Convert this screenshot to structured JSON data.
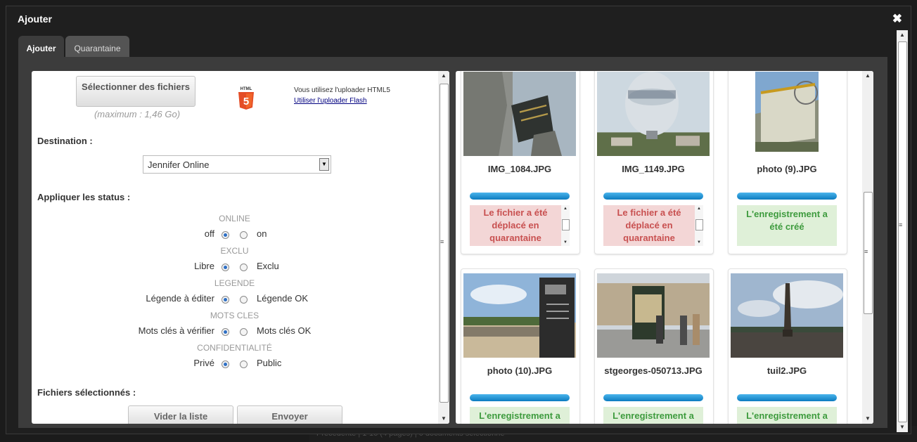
{
  "background": {
    "footer_text": "Précédente | 1-16 (4 pages) | 0 documents sélectionné"
  },
  "modal": {
    "title": "Ajouter",
    "close_glyph": "✖"
  },
  "tabs": [
    {
      "label": "Ajouter",
      "active": true
    },
    {
      "label": "Quarantaine",
      "active": false
    }
  ],
  "upload": {
    "select_button": "Sélectionner des fichiers",
    "max_text": "(maximum : 1,46 Go)",
    "html5_logo_text": "HTML",
    "html5_logo_number": "5",
    "uploader_info": "Vous utilisez l'uploader HTML5",
    "flash_link": "Utiliser l'uploader Flash"
  },
  "destination": {
    "label": "Destination :",
    "value": "Jennifer Online"
  },
  "status": {
    "label": "Appliquer les status :",
    "groups": [
      {
        "title": "ONLINE",
        "left": "off",
        "right": "on",
        "selected": "left"
      },
      {
        "title": "EXCLU",
        "left": "Libre",
        "right": "Exclu",
        "selected": "left"
      },
      {
        "title": "LEGENDE",
        "left": "Légende à éditer",
        "right": "Légende OK",
        "selected": "left"
      },
      {
        "title": "MOTS CLES",
        "left": "Mots clés à vérifier",
        "right": "Mots clés OK",
        "selected": "left"
      },
      {
        "title": "CONFIDENTIALITÉ",
        "left": "Privé",
        "right": "Public",
        "selected": "left"
      }
    ]
  },
  "files": {
    "label": "Fichiers sélectionnés :",
    "clear_button": "Vider la liste",
    "send_button": "Envoyer",
    "items": [
      {
        "name": "IMG_1084.JPG",
        "status": "error",
        "message": "Le fichier a été déplacé en quarantaine",
        "progress": 1.0
      },
      {
        "name": "IMG_1149.JPG",
        "status": "error",
        "message": "Le fichier a été déplacé en quarantaine",
        "progress": 1.0
      },
      {
        "name": "photo (9).JPG",
        "status": "ok",
        "message": "L'enregistrement a été créé",
        "progress": 1.0
      },
      {
        "name": "photo (10).JPG",
        "status": "ok",
        "message": "L'enregistrement a été créé",
        "progress": 1.0
      },
      {
        "name": "stgeorges-050713.JPG",
        "status": "ok",
        "message": "L'enregistrement a été créé",
        "progress": 1.0
      },
      {
        "name": "tuil2.JPG",
        "status": "ok",
        "message": "L'enregistrement a été créé",
        "progress": 1.0
      }
    ]
  },
  "icons": {
    "scroll_up": "▲",
    "scroll_down": "▼",
    "scroll_grip": "≡",
    "dropdown": "▼"
  },
  "colors": {
    "progress": "#0c7cc0",
    "error_bg": "#f3d6d6",
    "error_text": "#c85050",
    "ok_bg": "#dff0d8",
    "ok_text": "#3e9b3e",
    "radio_selected": "#2e6fc4"
  }
}
